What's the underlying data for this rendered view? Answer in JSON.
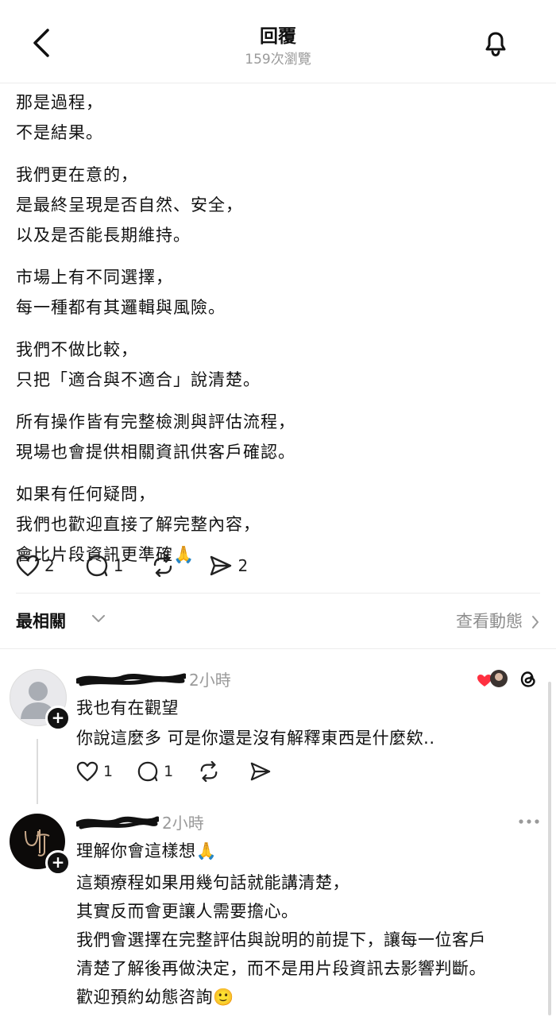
{
  "header": {
    "title": "回覆",
    "views": "159次瀏覽"
  },
  "post": {
    "paragraphs": [
      [
        "那是過程，",
        "不是結果。"
      ],
      [
        "我們更在意的，",
        "是最終呈現是否自然、安全，",
        "以及是否能長期維持。"
      ],
      [
        "市場上有不同選擇，",
        "每一種都有其邏輯與風險。"
      ],
      [
        "我們不做比較，",
        "只把「適合與不適合」說清楚。"
      ],
      [
        "所有操作皆有完整檢測與評估流程，",
        "現場也會提供相關資訊供客戶確認。"
      ],
      [
        "如果有任何疑問，",
        "我們也歡迎直接了解完整內容，",
        "會比片段資訊更準確🙏"
      ]
    ],
    "actions": {
      "likes": "2",
      "replies": "1",
      "shares": "2"
    }
  },
  "sortbar": {
    "label": "最相關",
    "activity": "查看動態"
  },
  "comments": [
    {
      "time": "2小時",
      "lines": [
        "我也有在觀望",
        "你說這麼多 可是你還是沒有解釋東西是什麼欸.."
      ],
      "likes": "1",
      "replies": "1"
    },
    {
      "time": "2小時",
      "lines": [
        "理解你會這樣想🙏",
        "這類療程如果用幾句話就能講清楚，",
        "其實反而會更讓人需要擔心。",
        "我們會選擇在完整評估與說明的前提下，讓每一位客戶",
        "清楚了解後再做決定，而不是用片段資訊去影響判斷。",
        "歡迎預約幼態咨詢🙂"
      ]
    }
  ],
  "colors": {
    "muted": "#9a9a9a",
    "heart": "#ff3040",
    "divider": "#ececec"
  },
  "icons": [
    "back-chevron-icon",
    "bell-icon",
    "heart-icon",
    "comment-icon",
    "repost-icon",
    "send-icon",
    "threads-logo-icon",
    "more-icon"
  ]
}
